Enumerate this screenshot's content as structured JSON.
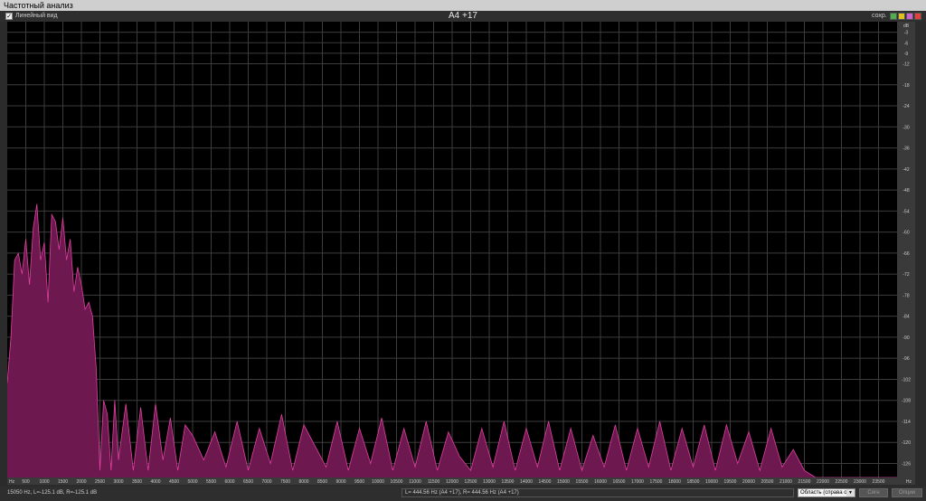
{
  "window": {
    "title": "Частотный анализ"
  },
  "toolbar": {
    "linear_view_label": "Линейный вид",
    "linear_view_checked": true,
    "note_label": "A4 +17",
    "comp_label": "сохр.",
    "window_controls": [
      {
        "name": "green-button",
        "color": "#4caf50"
      },
      {
        "name": "yellow-button",
        "color": "#e0c020"
      },
      {
        "name": "pink-button",
        "color": "#d060d0"
      },
      {
        "name": "red-button",
        "color": "#e04040"
      }
    ]
  },
  "chart_data": {
    "type": "area",
    "x_unit_label": "Hz",
    "y_unit_label": "dB",
    "xlim": [
      0,
      24000
    ],
    "ylim": [
      -130,
      0
    ],
    "x_ticks": [
      500,
      1000,
      1500,
      2000,
      2500,
      3000,
      3500,
      4000,
      4500,
      5000,
      5500,
      6000,
      6500,
      7000,
      7500,
      8000,
      8500,
      9000,
      9500,
      10000,
      10500,
      11000,
      11500,
      12000,
      12500,
      13000,
      13500,
      14000,
      14500,
      15000,
      15500,
      16000,
      16500,
      17000,
      17500,
      18000,
      18500,
      19000,
      19500,
      20000,
      20500,
      21000,
      21500,
      22000,
      22500,
      23000,
      23500
    ],
    "y_ticks": [
      -3,
      -6,
      -9,
      -12,
      -18,
      -24,
      -30,
      -36,
      -42,
      -48,
      -54,
      -60,
      -66,
      -72,
      -78,
      -84,
      -90,
      -96,
      -102,
      -108,
      -114,
      -120,
      -126
    ],
    "grid": true,
    "fill_color": "#6e1850",
    "line_color": "#e040a0",
    "series": [
      {
        "x": [
          0,
          100,
          200,
          300,
          400,
          500,
          600,
          700,
          800,
          900,
          1000,
          1100,
          1200,
          1300,
          1400,
          1500,
          1600,
          1700,
          1800,
          1900,
          2000,
          2100,
          2200,
          2300,
          2400,
          2500,
          2600,
          2700,
          2800,
          2900,
          3000,
          3200,
          3400,
          3600,
          3800,
          4000,
          4200,
          4400,
          4600,
          4800,
          5000,
          5300,
          5600,
          5900,
          6200,
          6500,
          6800,
          7100,
          7400,
          7700,
          8000,
          8300,
          8600,
          8900,
          9200,
          9500,
          9800,
          10100,
          10400,
          10700,
          11000,
          11300,
          11600,
          11900,
          12200,
          12500,
          12800,
          13100,
          13400,
          13700,
          14000,
          14300,
          14600,
          14900,
          15200,
          15500,
          15800,
          16100,
          16400,
          16700,
          17000,
          17300,
          17600,
          17900,
          18200,
          18500,
          18800,
          19100,
          19400,
          19700,
          20000,
          20300,
          20600,
          20900,
          21200,
          21500,
          21800,
          22500,
          23500,
          24000
        ],
        "y": [
          -103,
          -90,
          -68,
          -66,
          -72,
          -62,
          -75,
          -59,
          -52,
          -68,
          -63,
          -80,
          -55,
          -57,
          -65,
          -56,
          -68,
          -62,
          -77,
          -70,
          -75,
          -82,
          -80,
          -84,
          -99,
          -128,
          -108,
          -112,
          -128,
          -108,
          -125,
          -109,
          -128,
          -110,
          -128,
          -109,
          -125,
          -113,
          -128,
          -115,
          -118,
          -125,
          -117,
          -127,
          -114,
          -128,
          -116,
          -126,
          -112,
          -128,
          -115,
          -121,
          -127,
          -114,
          -128,
          -116,
          -126,
          -113,
          -128,
          -116,
          -127,
          -114,
          -128,
          -117,
          -124,
          -128,
          -116,
          -127,
          -114,
          -128,
          -116,
          -127,
          -114,
          -128,
          -116,
          -128,
          -118,
          -127,
          -115,
          -128,
          -116,
          -127,
          -114,
          -128,
          -116,
          -127,
          -115,
          -128,
          -115,
          -126,
          -117,
          -128,
          -116,
          -127,
          -122,
          -128,
          -130,
          -130,
          -130,
          -130
        ]
      }
    ]
  },
  "status": {
    "cursor_readout": "15050 Hz, L=-125.1 dB, R=-125.1 dB",
    "peak_readout": "L= 444.56 Hz (A4 +17), R= 444.56 Hz (A4 +17)",
    "range_select": "Область (справа о",
    "button_1": "Сигн",
    "button_2": "Опции"
  }
}
